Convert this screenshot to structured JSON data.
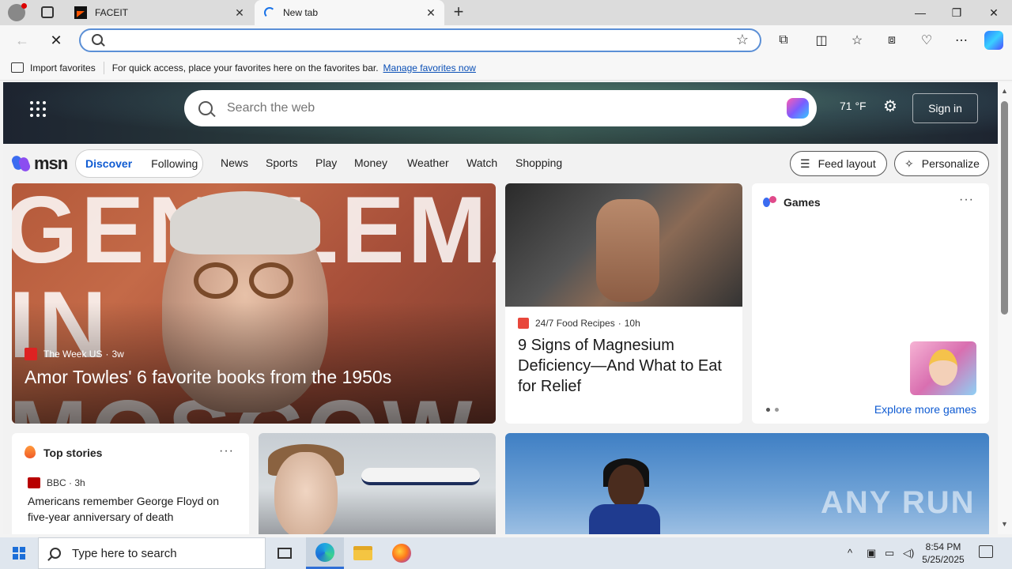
{
  "browser": {
    "tabs": [
      {
        "title": "FACEIT",
        "close": "✕"
      },
      {
        "title": "New tab",
        "close": "✕"
      }
    ],
    "new_tab_glyph": "+",
    "window_controls": {
      "minimize": "—",
      "restore": "❐",
      "close": "✕"
    },
    "nav": {
      "back": "←",
      "stop": "✕"
    },
    "address": {
      "value": "",
      "placeholder": ""
    },
    "toolbar_icons": [
      "extensions-icon",
      "split-screen-icon",
      "favorites-icon",
      "collections-icon",
      "performance-icon",
      "more-icon"
    ],
    "favorites_bar": {
      "import_label": "Import favorites",
      "message": "For quick access, place your favorites here on the favorites bar.",
      "manage_link": "Manage favorites now"
    }
  },
  "msn": {
    "search_placeholder": "Search the web",
    "weather": "71 °F",
    "sign_in": "Sign in",
    "logo_text": "msn",
    "segments": [
      "Discover",
      "Following"
    ],
    "nav_links": [
      "News",
      "Sports",
      "Play",
      "Money",
      "Weather",
      "Watch",
      "Shopping"
    ],
    "feed_layout": "Feed layout",
    "personalize": "Personalize",
    "hero": {
      "source": "The Week US",
      "age": "3w",
      "title": "Amor Towles' 6 favorite books from the 1950s",
      "image_text_1": "GENTLEMA",
      "image_text_2": "IN MOSCOW"
    },
    "magnesium": {
      "source": "24/7 Food Recipes",
      "age": "10h",
      "title": "9 Signs of Magnesium Deficiency—And What to Eat for Relief"
    },
    "games": {
      "title": "Games",
      "more": "···",
      "link": "Explore more games"
    },
    "top_stories": {
      "title": "Top stories",
      "more": "···",
      "source": "BBC",
      "age": "3h",
      "headline": "Americans remember George Floyd on five-year anniversary of death"
    },
    "watermark": "ANY RUN"
  },
  "taskbar": {
    "search_placeholder": "Type here to search",
    "time": "8:54 PM",
    "date": "5/25/2025"
  },
  "colors": {
    "accent": "#0f5bd2",
    "omnibox_border": "#5b8fd6"
  }
}
